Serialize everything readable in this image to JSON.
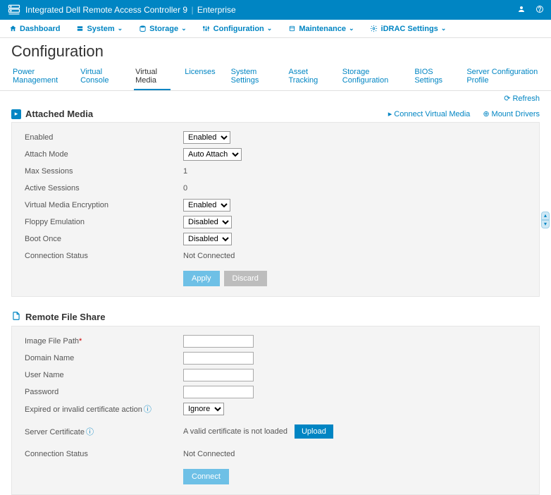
{
  "header": {
    "product": "Integrated Dell Remote Access Controller 9",
    "edition": "Enterprise"
  },
  "nav": {
    "dashboard": "Dashboard",
    "system": "System",
    "storage": "Storage",
    "configuration": "Configuration",
    "maintenance": "Maintenance",
    "idrac": "iDRAC Settings"
  },
  "page": {
    "title": "Configuration",
    "refresh": "Refresh"
  },
  "tabs": {
    "power": "Power Management",
    "console": "Virtual Console",
    "vmedia": "Virtual Media",
    "licenses": "Licenses",
    "syssettings": "System Settings",
    "asset": "Asset Tracking",
    "storagecfg": "Storage Configuration",
    "bios": "BIOS Settings",
    "servercfg": "Server Configuration Profile"
  },
  "attached": {
    "title": "Attached Media",
    "connect_link": "Connect Virtual Media",
    "mount_link": "Mount Drivers",
    "enabled_label": "Enabled",
    "enabled_value": "Enabled",
    "attach_mode_label": "Attach Mode",
    "attach_mode_value": "Auto Attach",
    "max_sessions_label": "Max Sessions",
    "max_sessions_value": "1",
    "active_sessions_label": "Active Sessions",
    "active_sessions_value": "0",
    "encryption_label": "Virtual Media Encryption",
    "encryption_value": "Enabled",
    "floppy_label": "Floppy Emulation",
    "floppy_value": "Disabled",
    "boot_once_label": "Boot Once",
    "boot_once_value": "Disabled",
    "conn_status_label": "Connection Status",
    "conn_status_value": "Not Connected",
    "apply": "Apply",
    "discard": "Discard"
  },
  "rfs": {
    "title": "Remote File Share",
    "image_path_label": "Image File Path",
    "domain_label": "Domain Name",
    "user_label": "User Name",
    "password_label": "Password",
    "cert_action_label": "Expired or invalid certificate action",
    "cert_action_value": "Ignore",
    "server_cert_label": "Server Certificate",
    "server_cert_status": "A valid certificate is not loaded",
    "upload": "Upload",
    "conn_status_label": "Connection Status",
    "conn_status_value": "Not Connected",
    "connect": "Connect"
  }
}
